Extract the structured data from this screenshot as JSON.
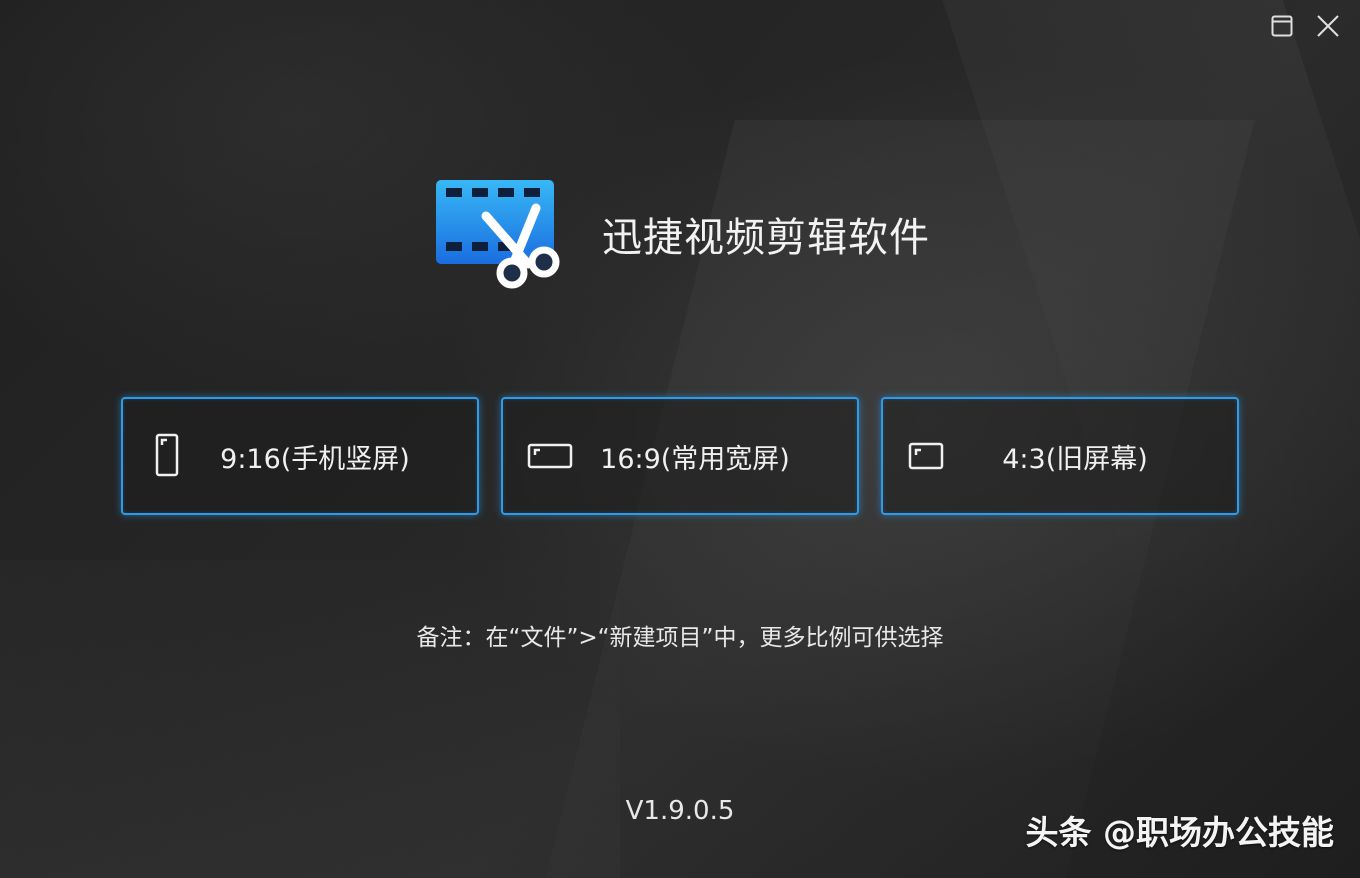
{
  "window": {
    "controls": {
      "maximize_icon": "maximize-icon",
      "close_icon": "close-icon"
    }
  },
  "brand": {
    "logo_icon": "video-scissors-icon",
    "title": "迅捷视频剪辑软件"
  },
  "ratios": [
    {
      "label": "9:16(手机竖屏)",
      "icon": "portrait-screen-icon"
    },
    {
      "label": "16:9(常用宽屏)",
      "icon": "widescreen-icon"
    },
    {
      "label": "4:3(旧屏幕)",
      "icon": "standard-screen-icon"
    }
  ],
  "note": "备注：在“文件”>“新建项目”中，更多比例可供选择",
  "version": "V1.9.0.5",
  "watermark": "头条 @职场办公技能",
  "colors": {
    "accent": "#2d9bea",
    "logo_gradient_top": "#36b5f5",
    "logo_gradient_bottom": "#1a6fe0",
    "background": "#222222"
  }
}
